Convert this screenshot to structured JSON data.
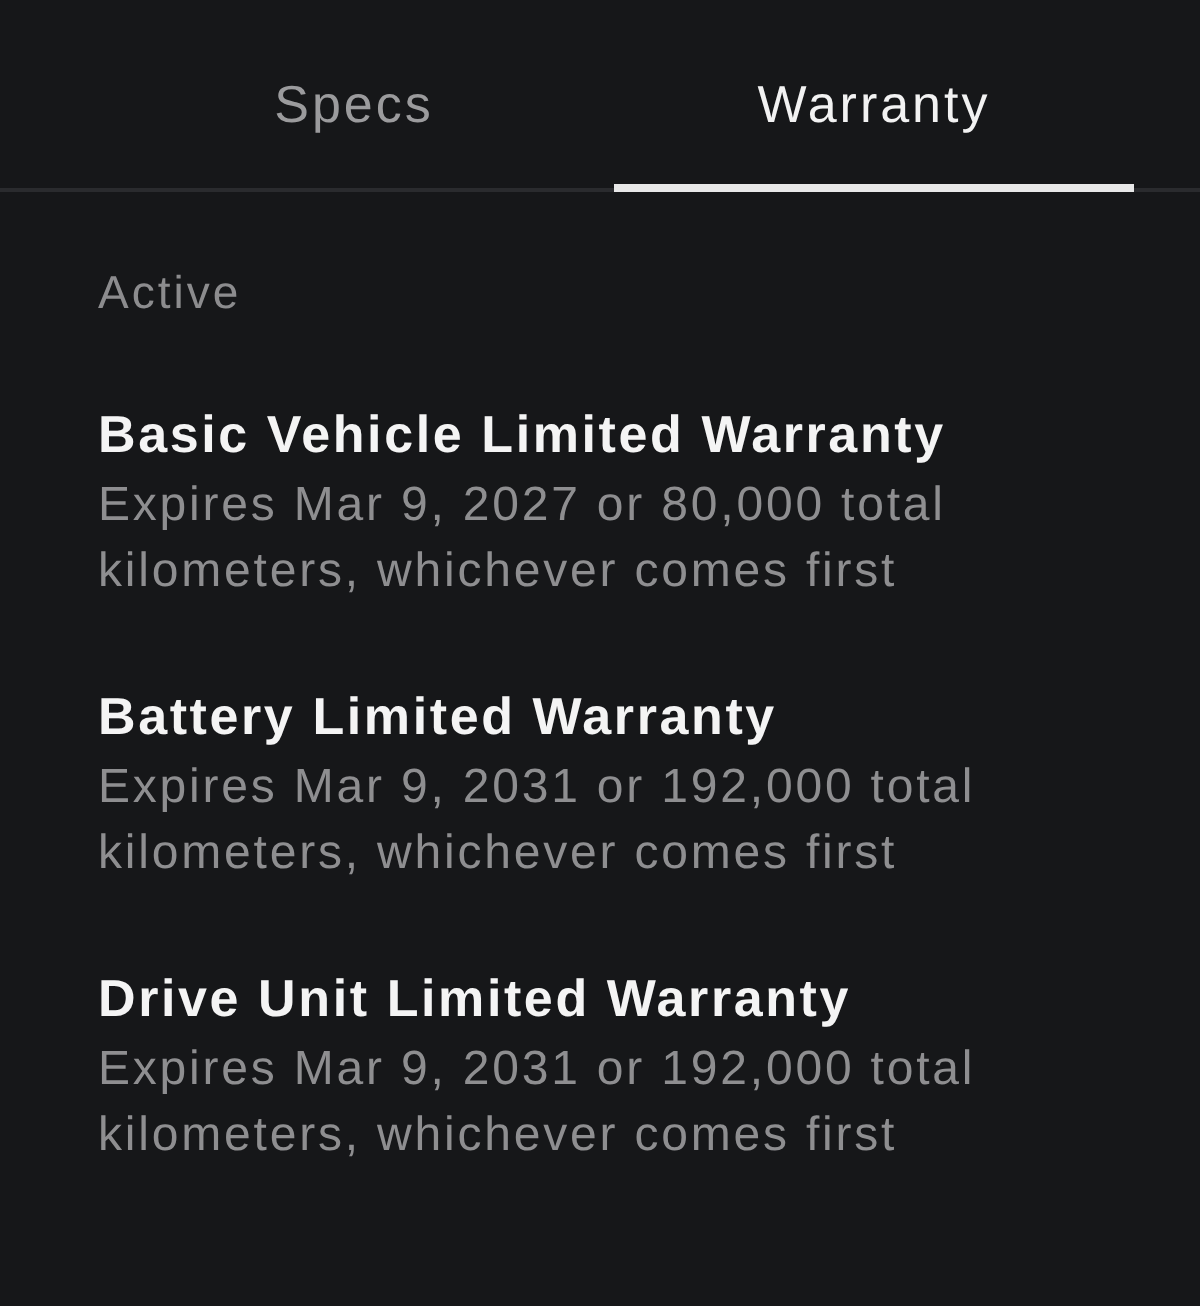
{
  "tabs": [
    {
      "label": "Specs",
      "selected": false
    },
    {
      "label": "Warranty",
      "selected": true
    }
  ],
  "section": {
    "heading": "Active"
  },
  "warranties": [
    {
      "title": "Basic Vehicle Limited Warranty",
      "description": "Expires Mar 9, 2027 or 80,000 total kilometers, whichever comes first"
    },
    {
      "title": "Battery Limited Warranty",
      "description": "Expires Mar 9, 2031 or 192,000 total kilometers, whichever comes first"
    },
    {
      "title": "Drive Unit Limited Warranty",
      "description": "Expires Mar 9, 2031 or 192,000 total kilometers, whichever comes first"
    }
  ]
}
